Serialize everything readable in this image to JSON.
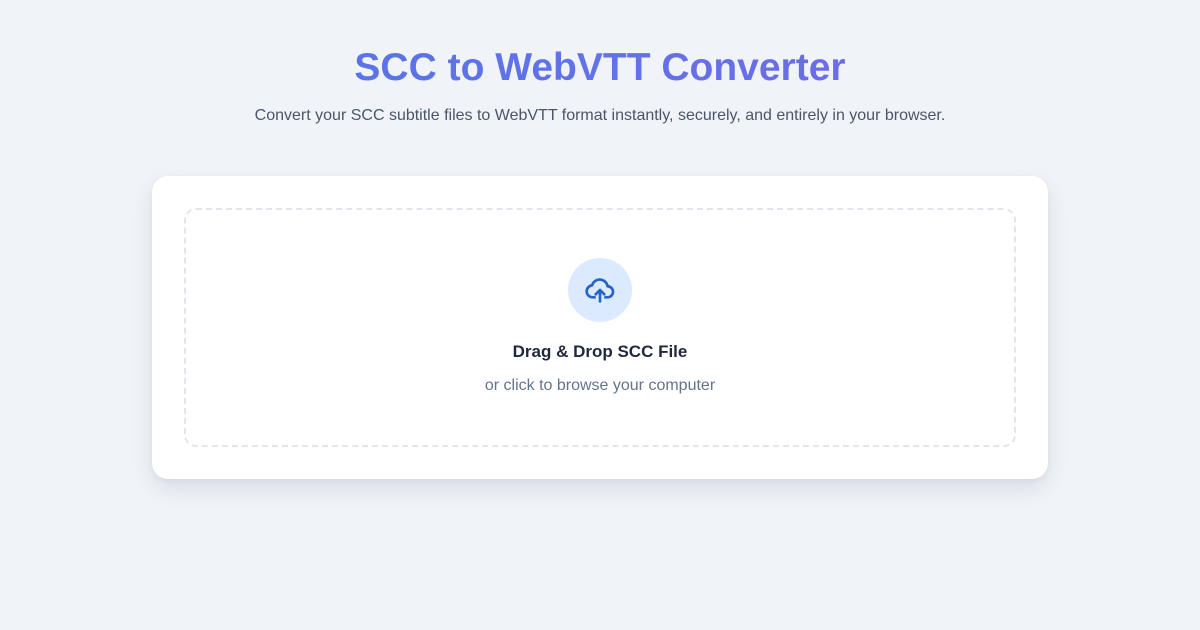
{
  "header": {
    "title": "SCC to WebVTT Converter",
    "subtitle": "Convert your SCC subtitle files to WebVTT format instantly, securely, and entirely in your browser."
  },
  "dropzone": {
    "icon": "cloud-upload-icon",
    "title": "Drag & Drop SCC File",
    "hint": "or click to browse your computer"
  },
  "colors": {
    "background": "#f0f4f9",
    "title_gradient_start": "#4f76e6",
    "title_gradient_end": "#7b63e3",
    "icon_circle_bg": "#dbeafe",
    "icon_stroke": "#2563c9",
    "card_bg": "#ffffff",
    "dropzone_border": "#e2e6ec"
  }
}
